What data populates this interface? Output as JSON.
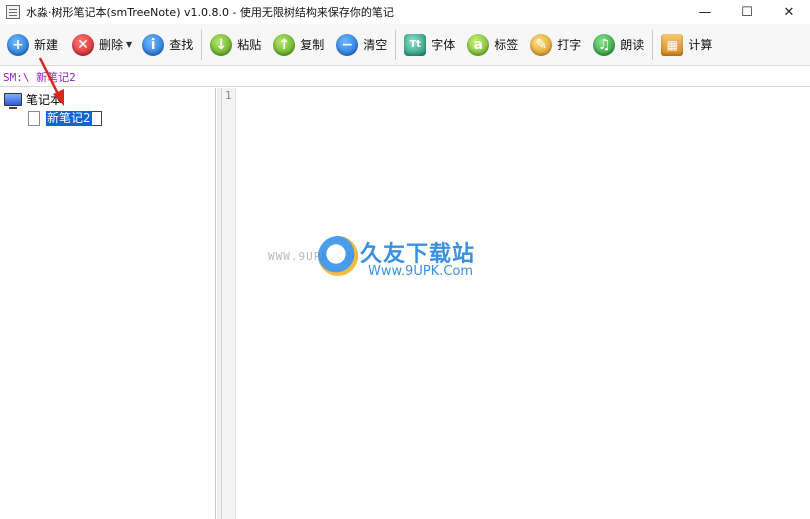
{
  "window": {
    "title": "水淼·树形笔记本(smTreeNote) v1.0.8.0 - 使用无限树结构来保存你的笔记",
    "controls": {
      "minimize": "—",
      "maximize": "☐",
      "close": "✕"
    }
  },
  "toolbar": {
    "buttons": [
      {
        "label": "新建",
        "icon": "plus-icon",
        "glyph": "+"
      },
      {
        "label": "删除",
        "icon": "delete-icon",
        "glyph": "✕"
      },
      {
        "label": "查找",
        "icon": "info-icon",
        "glyph": "i"
      },
      {
        "label": "粘贴",
        "icon": "paste-down-icon",
        "glyph": "↓"
      },
      {
        "label": "复制",
        "icon": "copy-up-icon",
        "glyph": "↑"
      },
      {
        "label": "清空",
        "icon": "clear-minus-icon",
        "glyph": "−"
      },
      {
        "label": "字体",
        "icon": "font-icon",
        "glyph": "Tt"
      },
      {
        "label": "标签",
        "icon": "tag-icon",
        "glyph": "a"
      },
      {
        "label": "打字",
        "icon": "pen-icon",
        "glyph": "✎"
      },
      {
        "label": "朗读",
        "icon": "headphones-icon",
        "glyph": "♫"
      },
      {
        "label": "计算",
        "icon": "calculator-icon",
        "glyph": "▦"
      }
    ]
  },
  "path": {
    "text": "SM:\\ 新笔记2"
  },
  "tree": {
    "root_label": "笔记本",
    "children": [
      {
        "label": "新笔记2",
        "selected": true,
        "editing": true
      }
    ]
  },
  "editor": {
    "line_numbers": [
      "1"
    ],
    "content": ""
  },
  "watermark": {
    "left_text": "WWW.9UPK.COM",
    "cn_text": "久友下载站",
    "url_text": "Www.9UPK.Com",
    "sub_text": "—————————————————"
  }
}
